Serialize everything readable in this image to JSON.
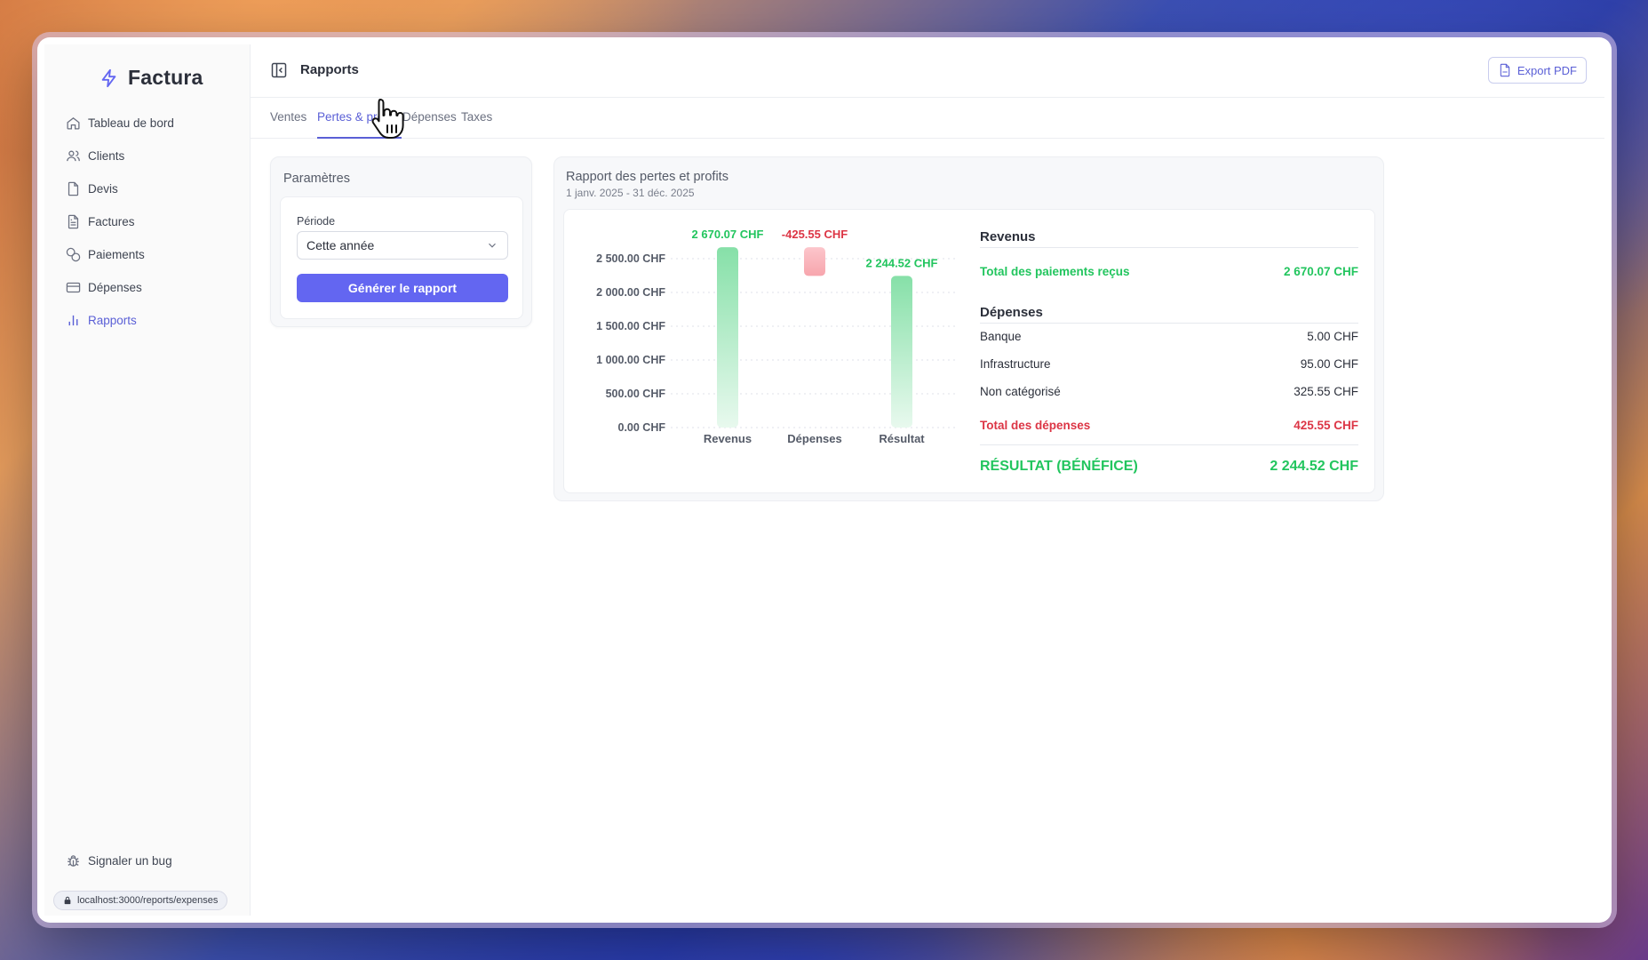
{
  "app": {
    "name": "Factura"
  },
  "sidebar": {
    "items": [
      {
        "label": "Tableau de bord",
        "icon": "home-icon"
      },
      {
        "label": "Clients",
        "icon": "users-icon"
      },
      {
        "label": "Devis",
        "icon": "file-icon"
      },
      {
        "label": "Factures",
        "icon": "file-text-icon"
      },
      {
        "label": "Paiements",
        "icon": "coins-icon"
      },
      {
        "label": "Dépenses",
        "icon": "credit-card-icon"
      },
      {
        "label": "Rapports",
        "icon": "bar-chart-icon",
        "active": true
      }
    ],
    "bug_label": "Signaler un bug",
    "url": "localhost:3000/reports/expenses"
  },
  "header": {
    "title": "Rapports",
    "export_label": "Export PDF"
  },
  "tabs": [
    {
      "label": "Ventes"
    },
    {
      "label": "Pertes & profits",
      "active": true
    },
    {
      "label": "Dépenses"
    },
    {
      "label": "Taxes"
    }
  ],
  "params": {
    "title": "Paramètres",
    "period_label": "Période",
    "period_value": "Cette année",
    "generate_label": "Générer le rapport"
  },
  "report": {
    "title": "Rapport des pertes et profits",
    "subtitle": "1 janv. 2025 - 31 déc. 2025",
    "revenus": {
      "heading": "Revenus",
      "total_label": "Total des paiements reçus",
      "total_value": "2 670.07 CHF"
    },
    "depenses": {
      "heading": "Dépenses",
      "rows": [
        {
          "label": "Banque",
          "value": "5.00 CHF"
        },
        {
          "label": "Infrastructure",
          "value": "95.00 CHF"
        },
        {
          "label": "Non catégorisé",
          "value": "325.55 CHF"
        }
      ],
      "total_label": "Total des dépenses",
      "total_value": "425.55 CHF"
    },
    "result_label": "RÉSULTAT (BÉNÉFICE)",
    "result_value": "2 244.52 CHF"
  },
  "colors": {
    "accent": "#6366f1",
    "positive": "#22c55e",
    "negative": "#dc3545"
  },
  "chart_data": {
    "type": "bar",
    "categories": [
      "Revenus",
      "Dépenses",
      "Résultat"
    ],
    "values": [
      2670.07,
      -425.55,
      2244.52
    ],
    "data_labels": [
      "2 670.07 CHF",
      "-425.55 CHF",
      "2 244.52 CHF"
    ],
    "y_ticks": [
      "0.00 CHF",
      "500.00 CHF",
      "1 000.00 CHF",
      "1 500.00 CHF",
      "2 000.00 CHF",
      "2 500.00 CHF"
    ],
    "y_tick_values": [
      0,
      500,
      1000,
      1500,
      2000,
      2500
    ],
    "ylim": [
      0,
      2670.07
    ],
    "grid": true
  }
}
